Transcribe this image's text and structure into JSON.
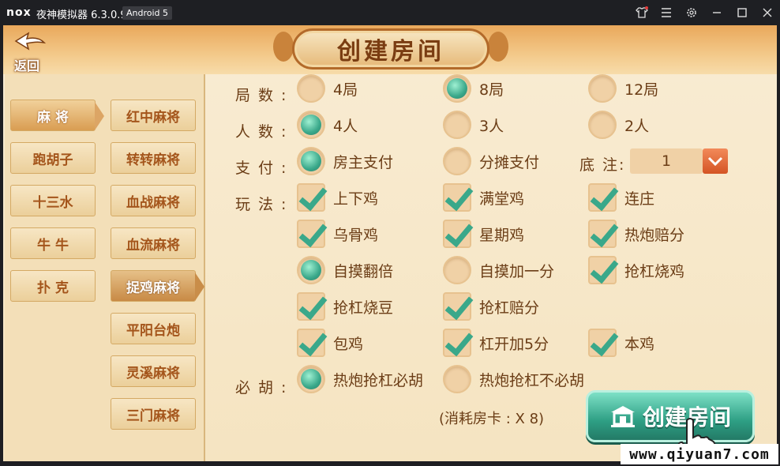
{
  "window": {
    "logo": "nox",
    "app_name": "夜神模拟器 6.3.0.9",
    "android_badge": "Android 5",
    "controls": [
      "shirt-icon",
      "menu-icon",
      "gear-icon",
      "minimize-icon",
      "maximize-icon",
      "close-icon"
    ]
  },
  "header": {
    "back_label": "返回",
    "title": "创建房间"
  },
  "categories": [
    {
      "label": "麻 将",
      "active": true
    },
    {
      "label": "跑胡子",
      "active": false
    },
    {
      "label": "十三水",
      "active": false
    },
    {
      "label": "牛 牛",
      "active": false
    },
    {
      "label": "扑 克",
      "active": false
    }
  ],
  "subtypes": [
    {
      "label": "红中麻将",
      "active": false
    },
    {
      "label": "转转麻将",
      "active": false
    },
    {
      "label": "血战麻将",
      "active": false
    },
    {
      "label": "血流麻将",
      "active": false
    },
    {
      "label": "捉鸡麻将",
      "active": true
    },
    {
      "label": "平阳台炮",
      "active": false
    },
    {
      "label": "灵溪麻将",
      "active": false
    },
    {
      "label": "三门麻将",
      "active": false
    }
  ],
  "form": {
    "rounds_label": "局数:",
    "rounds": [
      {
        "label": "4局",
        "checked": false
      },
      {
        "label": "8局",
        "checked": true
      },
      {
        "label": "12局",
        "checked": false
      }
    ],
    "players_label": "人数:",
    "players": [
      {
        "label": "4人",
        "checked": true
      },
      {
        "label": "3人",
        "checked": false
      },
      {
        "label": "2人",
        "checked": false
      }
    ],
    "payment_label": "支付:",
    "payment": [
      {
        "label": "房主支付",
        "checked": true
      },
      {
        "label": "分摊支付",
        "checked": false
      }
    ],
    "stake_label": "底 注:",
    "stake_value": "1",
    "rules_label": "玩法:",
    "rules": [
      {
        "label": "上下鸡",
        "type": "check",
        "checked": true
      },
      {
        "label": "满堂鸡",
        "type": "check",
        "checked": true
      },
      {
        "label": "连庄",
        "type": "check",
        "checked": true
      },
      {
        "label": "乌骨鸡",
        "type": "check",
        "checked": true
      },
      {
        "label": "星期鸡",
        "type": "check",
        "checked": true
      },
      {
        "label": "热炮赔分",
        "type": "check",
        "checked": true
      },
      {
        "label": "自摸翻倍",
        "type": "radio",
        "checked": true
      },
      {
        "label": "自摸加一分",
        "type": "radio",
        "checked": false
      },
      {
        "label": "抢杠烧鸡",
        "type": "check",
        "checked": true
      },
      {
        "label": "抢杠烧豆",
        "type": "check",
        "checked": true
      },
      {
        "label": "抢杠赔分",
        "type": "check",
        "checked": true
      },
      {
        "label": "包鸡",
        "type": "check",
        "checked": true
      },
      {
        "label": "杠开加5分",
        "type": "check",
        "checked": true
      },
      {
        "label": "本鸡",
        "type": "check",
        "checked": true
      }
    ],
    "must_hu_label": "必胡:",
    "must_hu": [
      {
        "label": "热炮抢杠必胡",
        "checked": true
      },
      {
        "label": "热炮抢杠不必胡",
        "checked": false
      }
    ],
    "cost_text": "(消耗房卡 : X 8)",
    "create_label": "创建房间"
  },
  "watermark": "www.qiyuan7.com",
  "colors": {
    "accent_green": "#3aa88a",
    "text_brown": "#6b3d16",
    "header_orange": "#e9a85b"
  }
}
